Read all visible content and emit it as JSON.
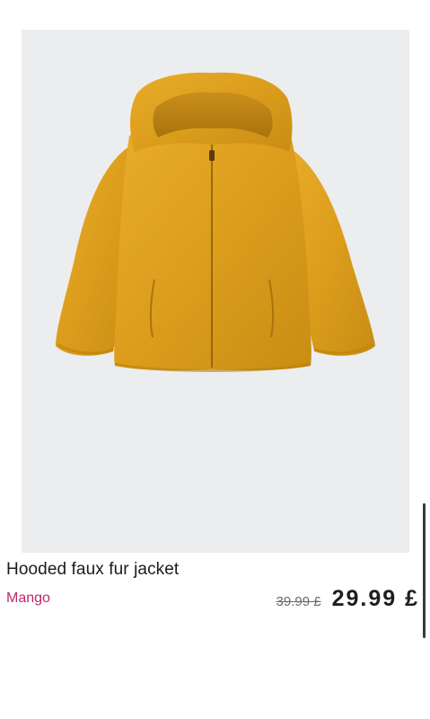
{
  "product": {
    "title": "Hooded faux fur jacket",
    "brand": "Mango",
    "old_price": "39.99 £",
    "price": "29.99 £",
    "image_icon": "yellow-hooded-faux-fur-jacket"
  },
  "colors": {
    "brand": "#c0266b",
    "image_background": "#ecedef",
    "jacket": "#e0a11f"
  }
}
